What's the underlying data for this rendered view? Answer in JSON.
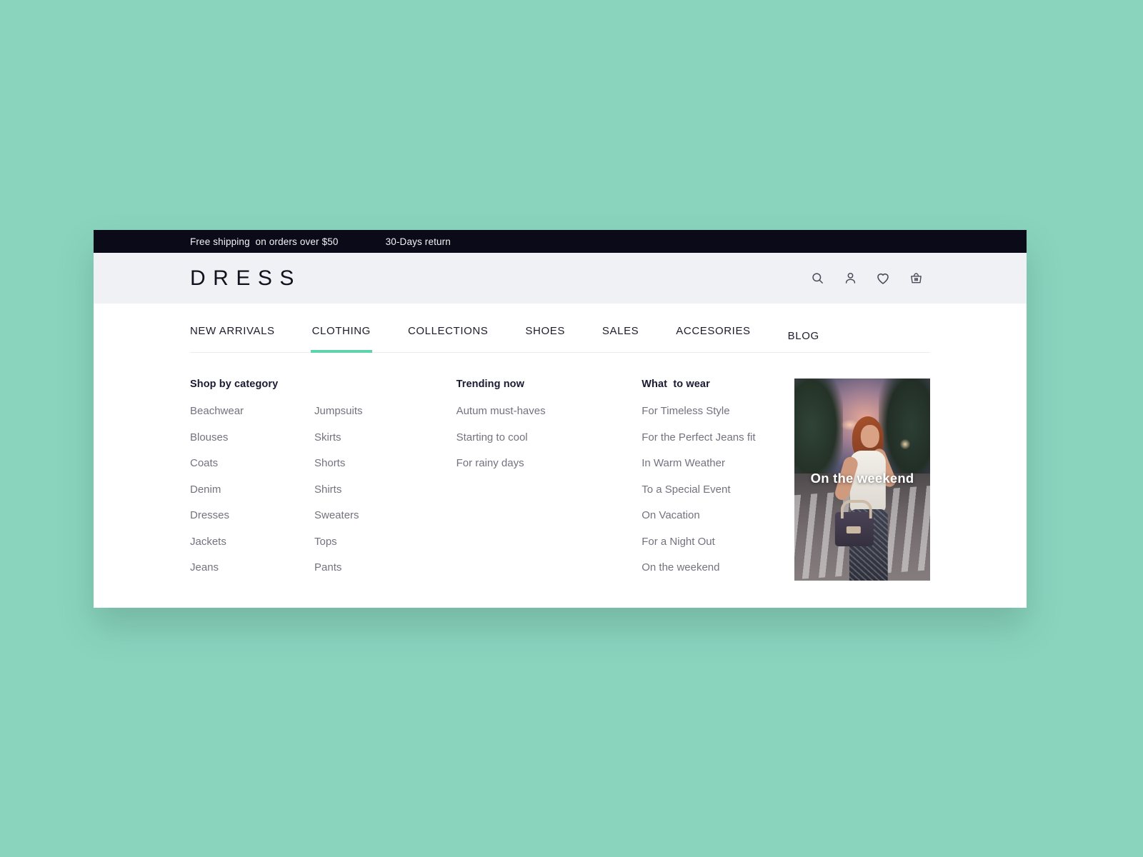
{
  "announcement": {
    "shipping": "Free shipping  on orders over $50",
    "returns": "30-Days return"
  },
  "header": {
    "logo": "DRESS",
    "icons": [
      {
        "name": "search-icon",
        "label": "Search"
      },
      {
        "name": "user-icon",
        "label": "Account"
      },
      {
        "name": "heart-icon",
        "label": "Wishlist"
      },
      {
        "name": "basket-icon",
        "label": "Cart"
      }
    ]
  },
  "nav": {
    "items": [
      {
        "label": "NEW ARRIVALS",
        "active": false
      },
      {
        "label": "CLOTHING",
        "active": true
      },
      {
        "label": "COLLECTIONS",
        "active": false
      },
      {
        "label": "SHOES",
        "active": false
      },
      {
        "label": "SALES",
        "active": false
      },
      {
        "label": "ACCESORIES",
        "active": false
      },
      {
        "label": "BLOG",
        "active": false
      }
    ],
    "active_label": "CLOTHING",
    "active_underline_color": "#5fd3ac"
  },
  "mega_menu": {
    "category": {
      "heading": "Shop by category",
      "column_left": [
        "Beachwear",
        "Blouses",
        "Coats",
        "Denim",
        "Dresses",
        "Jackets",
        "Jeans"
      ],
      "column_right": [
        "Jumpsuits",
        "Skirts",
        "Shorts",
        "Shirts",
        "Sweaters",
        "Tops",
        "Pants"
      ]
    },
    "trending": {
      "heading": "Trending now",
      "items": [
        "Autum must-haves",
        "Starting to cool",
        "For rainy days"
      ]
    },
    "what_to_wear": {
      "heading": "What  to wear",
      "items": [
        "For Timeless Style",
        "For the Perfect Jeans fit",
        "In Warm Weather",
        "To a Special Event",
        "On Vacation",
        "For a Night Out",
        "On the weekend"
      ]
    },
    "promo": {
      "caption": "On the weekend",
      "alt": "Woman in white top and patterned trousers holding a handbag on a city crosswalk at dusk"
    }
  },
  "colors": {
    "page_background": "#8ad4be",
    "announcement_bar": "#0a0a18",
    "logo_band": "#f0f1f5",
    "accent": "#5fd3ac",
    "link_text": "#73737f",
    "heading_text": "#1a1a33"
  }
}
